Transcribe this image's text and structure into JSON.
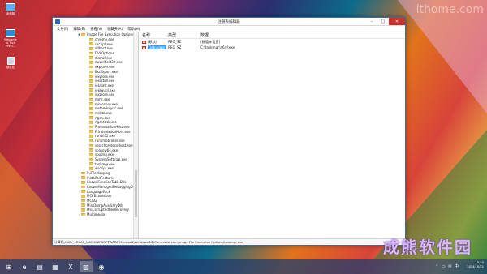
{
  "desktop": {
    "icons": [
      {
        "label": "此电脑",
        "icon": "computer-icon"
      },
      {
        "label": "Welcome to Tech Previ...",
        "icon": "welcome-icon"
      },
      {
        "label": "回收站",
        "icon": "recycle-bin-icon"
      }
    ],
    "watermark_top": "ithome.com",
    "watermark_bottom": "成熊软件园"
  },
  "window": {
    "title": "注册表编辑器",
    "menu": [
      "文件(F)",
      "编辑(E)",
      "查看(V)",
      "收藏夹(A)",
      "帮助(H)"
    ],
    "tree": {
      "items": [
        {
          "label": "Image File Execution Options",
          "expander": "▼",
          "indent": 1
        },
        {
          "label": "chrome.exe",
          "expander": "",
          "indent": 2
        },
        {
          "label": "cscript.exe",
          "expander": "",
          "indent": 2
        },
        {
          "label": "dllhost.exe",
          "expander": "",
          "indent": 2
        },
        {
          "label": "DVAOptions",
          "expander": "",
          "indent": 2
        },
        {
          "label": "dxorat.exe",
          "expander": "",
          "indent": 2
        },
        {
          "label": "dwwdhost32.exe",
          "expander": "",
          "indent": 2
        },
        {
          "label": "explorer.exe",
          "expander": "",
          "indent": 2
        },
        {
          "label": "ExtExport.exe",
          "expander": "",
          "indent": 2
        },
        {
          "label": "iexplore.exe",
          "expander": "",
          "indent": 2
        },
        {
          "label": "iexrstall.exe",
          "expander": "",
          "indent": 2
        },
        {
          "label": "ieUnatt.exe",
          "expander": "",
          "indent": 2
        },
        {
          "label": "ielowutil.exe",
          "expander": "",
          "indent": 2
        },
        {
          "label": "iexplore.exe",
          "expander": "",
          "indent": 2
        },
        {
          "label": "mmc.exe",
          "expander": "",
          "indent": 2
        },
        {
          "label": "mscorsvw.exe",
          "expander": "",
          "indent": 2
        },
        {
          "label": "msfeedssync.exe",
          "expander": "",
          "indent": 2
        },
        {
          "label": "mshta.exe",
          "expander": "",
          "indent": 2
        },
        {
          "label": "ngen.exe",
          "expander": "",
          "indent": 2
        },
        {
          "label": "ngentask.exe",
          "expander": "",
          "indent": 2
        },
        {
          "label": "PresentationHost.exe",
          "expander": "",
          "indent": 2
        },
        {
          "label": "PrintIsolationHost.exe",
          "expander": "",
          "indent": 2
        },
        {
          "label": "rundll32.exe",
          "expander": "",
          "indent": 2
        },
        {
          "label": "runtimebroker.exe",
          "expander": "",
          "indent": 2
        },
        {
          "label": "searchprotocolhost.exe",
          "expander": "",
          "indent": 2
        },
        {
          "label": "splwow64.exe",
          "expander": "",
          "indent": 2
        },
        {
          "label": "spoolsv.exe",
          "expander": "",
          "indent": 2
        },
        {
          "label": "SystemSettings.exe",
          "expander": "",
          "indent": 2
        },
        {
          "label": "taskmgr.exe",
          "expander": "",
          "indent": 2
        },
        {
          "label": "wscript.exe",
          "expander": "",
          "indent": 2
        },
        {
          "label": "IniFileMapping",
          "expander": "›",
          "indent": 1
        },
        {
          "label": "InstalledFeatures",
          "expander": "›",
          "indent": 1
        },
        {
          "label": "KnownFunctionTableDlls",
          "expander": "",
          "indent": 1
        },
        {
          "label": "KnownManagedDebuggingDlls",
          "expander": "",
          "indent": 1
        },
        {
          "label": "LanguagePack",
          "expander": "›",
          "indent": 1
        },
        {
          "label": "MCI Extensions",
          "expander": "",
          "indent": 1
        },
        {
          "label": "MCI32",
          "expander": "",
          "indent": 1
        },
        {
          "label": "MiniDumpAuxiliaryDlls",
          "expander": "",
          "indent": 1
        },
        {
          "label": "MsiCorruptedFileRecovery",
          "expander": "",
          "indent": 1
        },
        {
          "label": "Multimedia",
          "expander": "›",
          "indent": 1
        }
      ]
    },
    "values": {
      "headers": {
        "name": "名称",
        "type": "类型",
        "data": "数据"
      },
      "rows": [
        {
          "name": "(默认)",
          "type": "REG_SZ",
          "data": "(数值未设置)",
          "kind": "str",
          "selected": false
        },
        {
          "name": "Debugger",
          "type": "REG_SZ",
          "data": "C:\\taskmgr\\a64f.exe",
          "kind": "str",
          "selected": true
        }
      ]
    },
    "statusbar": "计算机\\HKEY_LOCAL_MACHINE\\SOFTWARE\\Microsoft\\Windows NT\\CurrentVersion\\Image File Execution Options\\taskmgr.exe"
  },
  "taskbar": {
    "items": [
      {
        "name": "start-button",
        "glyph": "⊞",
        "active": false
      },
      {
        "name": "taskbar-ie",
        "glyph": "e",
        "active": false
      },
      {
        "name": "taskbar-explorer",
        "glyph": "▤",
        "active": false
      },
      {
        "name": "taskbar-store",
        "glyph": "▦",
        "active": false
      },
      {
        "name": "taskbar-excel",
        "glyph": "X",
        "active": false
      },
      {
        "name": "taskbar-regedit",
        "glyph": "▧",
        "active": true
      },
      {
        "name": "taskbar-app",
        "glyph": "◉",
        "active": false
      }
    ],
    "tray_icons": "⌃ ▭ ✉ 中",
    "time": "15:40",
    "date": "2014/10/21"
  }
}
